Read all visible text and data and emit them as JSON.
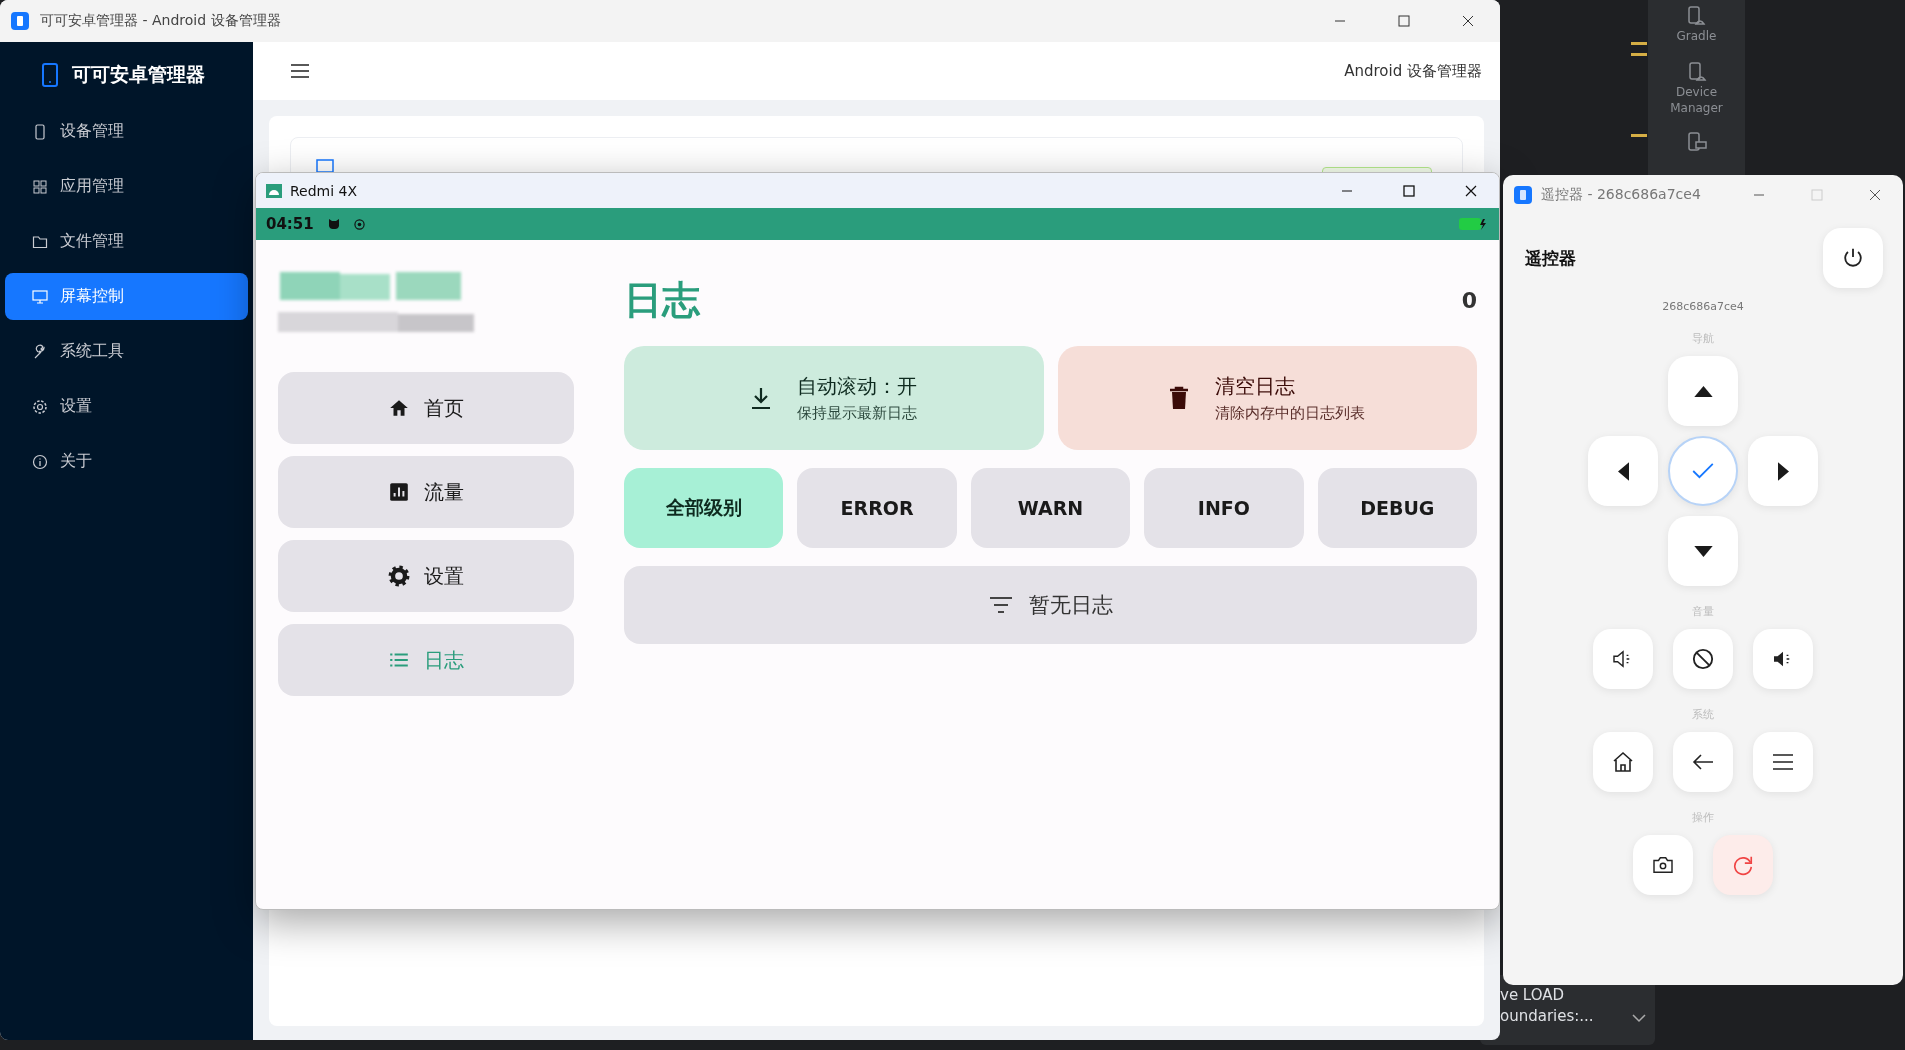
{
  "ide": {
    "tool_windows": [
      {
        "label": "Gradle"
      },
      {
        "label": "Device Manager"
      }
    ],
    "notification": {
      "lines": [
        "ve LOAD",
        "oundaries:..."
      ]
    }
  },
  "main_window": {
    "title": "可可安卓管理器 - Android 设备管理器",
    "app_name": "可可安卓管理器",
    "header_title": "Android 设备管理器",
    "sidebar": [
      {
        "label": "设备管理",
        "selected": false
      },
      {
        "label": "应用管理",
        "selected": false
      },
      {
        "label": "文件管理",
        "selected": false
      },
      {
        "label": "屏幕控制",
        "selected": true
      },
      {
        "label": "系统工具",
        "selected": false
      },
      {
        "label": "设置",
        "selected": false
      },
      {
        "label": "关于",
        "selected": false
      }
    ]
  },
  "phone_window": {
    "title": "Redmi 4X",
    "status_bar": {
      "time": "04:51"
    },
    "nav": [
      {
        "label": "首页",
        "selected": false
      },
      {
        "label": "流量",
        "selected": false
      },
      {
        "label": "设置",
        "selected": false
      },
      {
        "label": "日志",
        "selected": true
      }
    ],
    "page": {
      "title": "日志",
      "count": "0",
      "actions": [
        {
          "kind": "autoscroll",
          "title": "自动滚动：开",
          "subtitle": "保持显示最新日志"
        },
        {
          "kind": "clear",
          "title": "清空日志",
          "subtitle": "清除内存中的日志列表"
        }
      ],
      "filters": [
        {
          "label": "全部级别",
          "selected": true
        },
        {
          "label": "ERROR",
          "selected": false
        },
        {
          "label": "WARN",
          "selected": false
        },
        {
          "label": "INFO",
          "selected": false
        },
        {
          "label": "DEBUG",
          "selected": false
        }
      ],
      "empty_message": "暂无日志"
    }
  },
  "remote_window": {
    "title": "遥控器 - 268c686a7ce4",
    "heading": "遥控器",
    "serial": "268c686a7ce4",
    "sections": [
      {
        "kind": "dpad",
        "label": "导航"
      },
      {
        "kind": "volume",
        "label": "音量"
      },
      {
        "kind": "system",
        "label": "系统"
      },
      {
        "kind": "actions",
        "label": "操作"
      }
    ]
  }
}
